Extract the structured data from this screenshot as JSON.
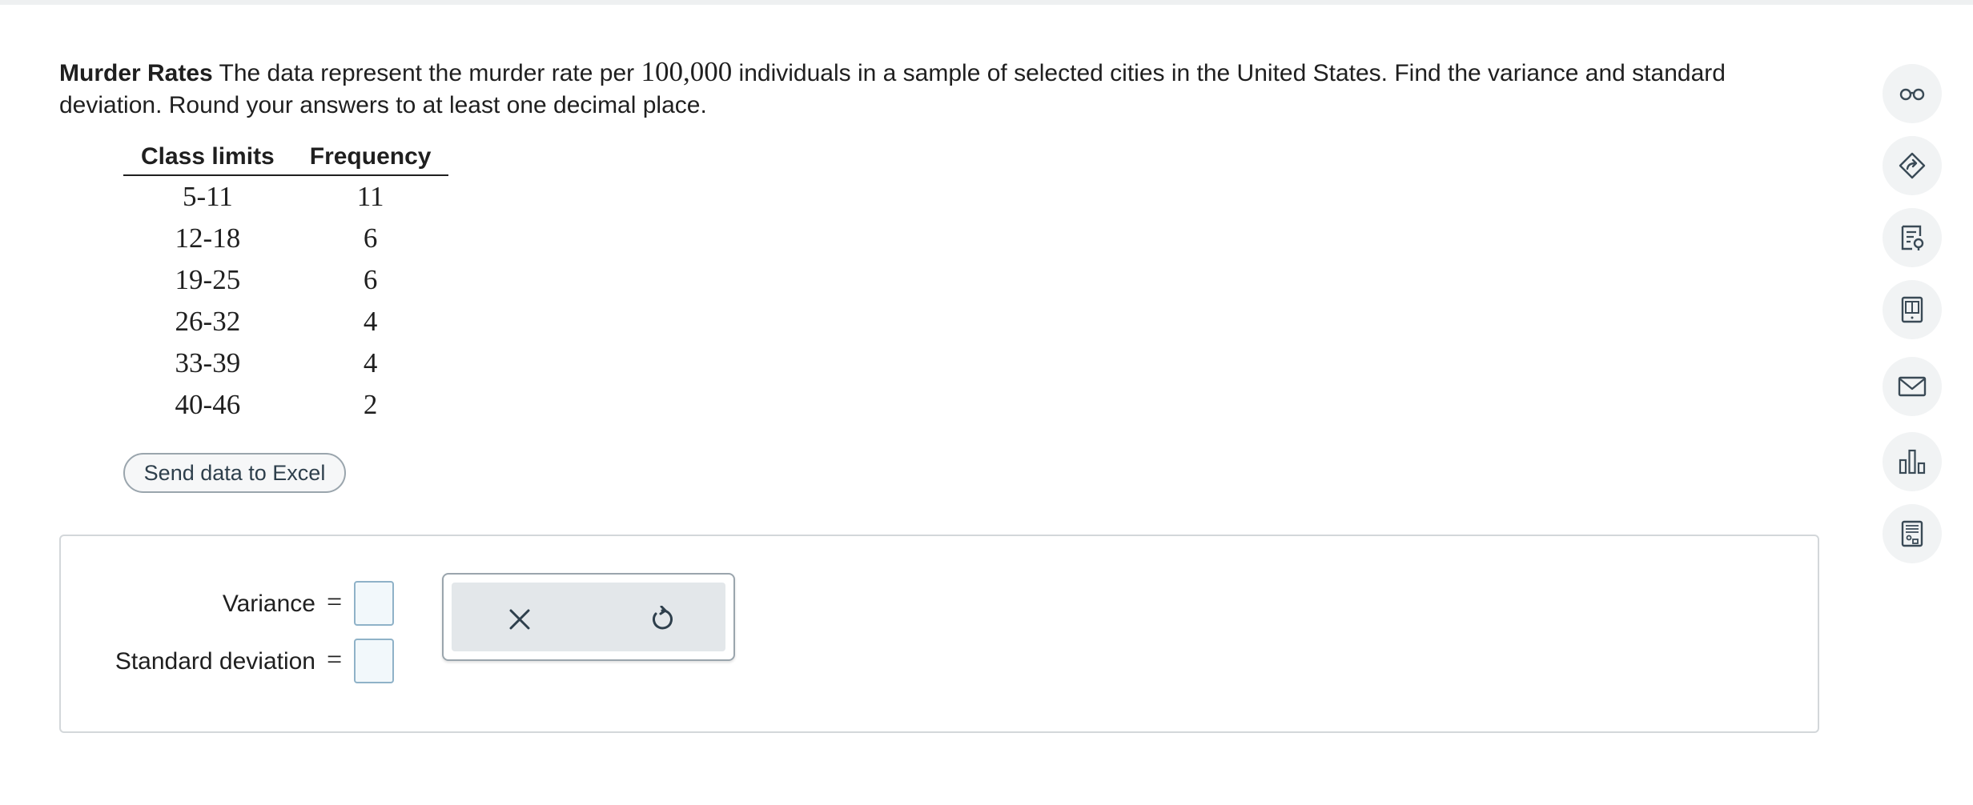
{
  "question": {
    "title": "Murder Rates",
    "text_before": " The data represent the murder rate per ",
    "number": "100,000",
    "text_after": " individuals in a sample of selected cities in the United States. Find the variance and standard deviation. Round your answers to at least one decimal place."
  },
  "table": {
    "headers": [
      "Class limits",
      "Frequency"
    ],
    "rows": [
      {
        "class": "5-11",
        "freq": "11"
      },
      {
        "class": "12-18",
        "freq": "6"
      },
      {
        "class": "19-25",
        "freq": "6"
      },
      {
        "class": "26-32",
        "freq": "4"
      },
      {
        "class": "33-39",
        "freq": "4"
      },
      {
        "class": "40-46",
        "freq": "2"
      }
    ]
  },
  "excel_button": "Send data to Excel",
  "answers": {
    "variance_label": "Variance",
    "sd_label": "Standard deviation",
    "equals": "=",
    "variance_value": "",
    "sd_value": ""
  },
  "tools": {
    "clear_icon": "x-icon",
    "undo_icon": "undo-icon"
  },
  "rail": [
    "glasses-icon",
    "edit-tag-icon",
    "document-search-icon",
    "ebook-icon",
    "mail-icon",
    "bar-chart-icon",
    "calculator-icon"
  ],
  "colors": {
    "accent": "#2e3f4c",
    "input_border": "#8fb2c8",
    "input_fill": "#f2f8fb",
    "tool_fill": "#e3e7ea"
  }
}
